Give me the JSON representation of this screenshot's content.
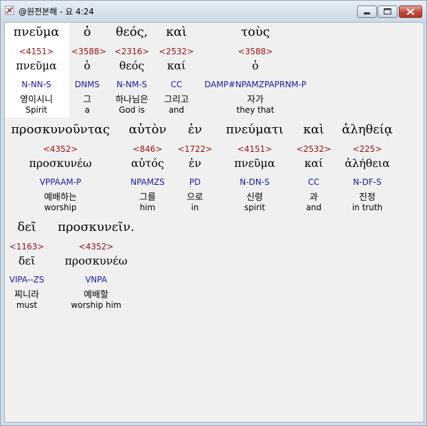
{
  "window": {
    "title": "@원전본해 - 요 4:24"
  },
  "words": [
    {
      "greek": "πνεῦμα",
      "strong": "<4151>",
      "lemma": "πνεῦμα",
      "parsing": "N-NN-S",
      "korean": "영이시니",
      "english": "Spirit"
    },
    {
      "greek": "ὁ",
      "strong": "<3588>",
      "lemma": "ὁ",
      "parsing": "DNMS",
      "korean": "그",
      "english": "a"
    },
    {
      "greek": "θεός,",
      "strong": "<2316>",
      "lemma": "θεός",
      "parsing": "N-NM-S",
      "korean": "하나님은",
      "english": "God is"
    },
    {
      "greek": "καὶ",
      "strong": "<2532>",
      "lemma": "καί",
      "parsing": "CC",
      "korean": "그리고",
      "english": "and"
    },
    {
      "greek": "τοὺς",
      "strong": "<3588>",
      "lemma": "ὁ",
      "parsing": "DAMP#NPAMZPAPRNM-P",
      "korean": "자가",
      "english": "they that"
    },
    {
      "greek": "προσκυνοῦντας",
      "strong": "<4352>",
      "lemma": "προσκυνέω",
      "parsing": "VPPAAM-P",
      "korean": "예배하는",
      "english": "worship"
    },
    {
      "greek": "αὐτὸν",
      "strong": "<846>",
      "lemma": "αὐτός",
      "parsing": "NPAMZS",
      "korean": "그를",
      "english": "him"
    },
    {
      "greek": "ἐν",
      "strong": "<1722>",
      "lemma": "ἐν",
      "parsing": "PD",
      "korean": "으로",
      "english": "in"
    },
    {
      "greek": "πνεύματι",
      "strong": "<4151>",
      "lemma": "πνεῦμα",
      "parsing": "N-DN-S",
      "korean": "신령",
      "english": "spirit"
    },
    {
      "greek": "καὶ",
      "strong": "<2532>",
      "lemma": "καί",
      "parsing": "CC",
      "korean": "과",
      "english": "and"
    },
    {
      "greek": "ἀληθείᾳ",
      "strong": "<225>",
      "lemma": "ἀλήθεια",
      "parsing": "N-DF-S",
      "korean": "진정",
      "english": "in truth"
    },
    {
      "greek": "δεῖ",
      "strong": "<1163>",
      "lemma": "δεῖ",
      "parsing": "VIPA--ZS",
      "korean": "찌니라",
      "english": "must"
    },
    {
      "greek": "προσκυνεῖν.",
      "strong": "<4352>",
      "lemma": "προσκυνέω",
      "parsing": "VNPA",
      "korean": "예배할",
      "english": "worship him"
    }
  ]
}
